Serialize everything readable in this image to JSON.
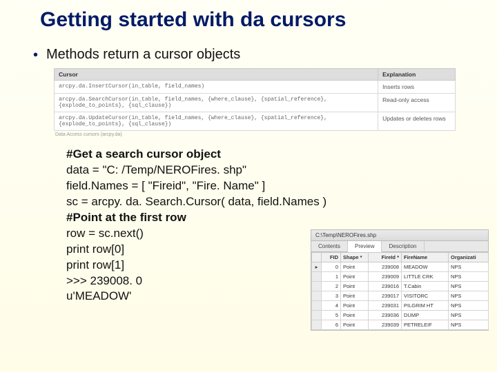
{
  "title": "Getting started with  da cursors",
  "bullet": "Methods return a cursor objects",
  "cursor_table": {
    "headers": {
      "cursor": "Cursor",
      "explanation": "Explanation"
    },
    "rows": [
      {
        "code": "arcpy.da.InsertCursor(in_table, field_names)",
        "expl": "Inserts rows"
      },
      {
        "code": "arcpy.da.SearchCursor(in_table, field_names, {where_clause}, {spatial_reference}, {explode_to_points}, {sql_clause})",
        "expl": "Read-only access"
      },
      {
        "code": "arcpy.da.UpdateCursor(in_table, field_names, {where_clause}, {spatial_reference}, {explode_to_points}, {sql_clause})",
        "expl": "Updates or deletes rows"
      }
    ],
    "footnote": "Data Access cursors (arcpy.da)"
  },
  "code": {
    "l1": "#Get a search cursor object",
    "l2": "data = \"C: /Temp/NEROFires. shp\"",
    "l3": "field.Names = [ \"Fireid\", \"Fire. Name\" ]",
    "l4": "sc = arcpy. da. Search.Cursor( data, field.Names )",
    "l5": "#Point at the first row",
    "l6": "row = sc.next()",
    "l7": "print row[0]",
    "l8": "print row[1]",
    "l9": ">>> 239008. 0",
    "l10": "u'MEADOW'"
  },
  "attr": {
    "titlebar": "C:\\Temp\\NEROFires.shp",
    "tabs": {
      "contents": "Contents",
      "preview": "Preview",
      "description": "Description"
    },
    "columns": {
      "fid": "FID",
      "shape": "Shape *",
      "fireid": "FireId *",
      "firename": "FireName",
      "org": "Organizati"
    },
    "rows": [
      {
        "fid": "0",
        "shape": "Point",
        "fireid": "239008",
        "firename": "MEADOW",
        "org": "NPS"
      },
      {
        "fid": "1",
        "shape": "Point",
        "fireid": "239009",
        "firename": "LITTLE CRK",
        "org": "NPS"
      },
      {
        "fid": "2",
        "shape": "Point",
        "fireid": "239016",
        "firename": "T.Cabin",
        "org": "NPS"
      },
      {
        "fid": "3",
        "shape": "Point",
        "fireid": "239017",
        "firename": "VISITORC",
        "org": "NPS"
      },
      {
        "fid": "4",
        "shape": "Point",
        "fireid": "239031",
        "firename": "PILGRIM HT",
        "org": "NPS"
      },
      {
        "fid": "5",
        "shape": "Point",
        "fireid": "239036",
        "firename": "DUMP",
        "org": "NPS"
      },
      {
        "fid": "6",
        "shape": "Point",
        "fireid": "239039",
        "firename": "PETRELEIF",
        "org": "NPS"
      }
    ]
  }
}
